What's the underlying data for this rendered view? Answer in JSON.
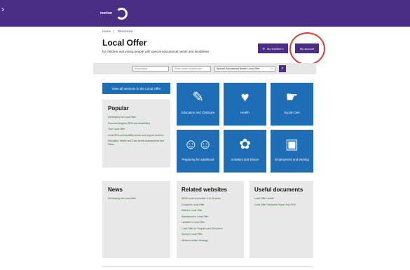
{
  "header": {
    "logo_text": "merton",
    "back_icon": "chevron-right-icon"
  },
  "breadcrumb": {
    "items": [
      "Home",
      "Directories"
    ]
  },
  "page": {
    "title": "Local Offer",
    "subtitle": "for children and young people with special educational needs and disabilities"
  },
  "actions": {
    "shortlist_label": "My shortlist 0",
    "account_label": "My account"
  },
  "search": {
    "keyword_placeholder": "Keyword(s)",
    "location_placeholder": "Place name or postcode",
    "category_value": "Special Educational Needs Local Offer",
    "submit_icon": "search-icon"
  },
  "view_all_label": "View all services in the Local Offer",
  "popular": {
    "title": "Popular",
    "links": [
      "Developing the Local Offer",
      "Personal Budgets (SEN and disabilities)",
      "Your Local Offer",
      "Local SEN and disability advice and support services",
      "Education, Health and Care Needs Assessments and Plans"
    ]
  },
  "tiles": [
    {
      "label": "Education and Childcare",
      "icon": "education-icon"
    },
    {
      "label": "Health",
      "icon": "heart-icon"
    },
    {
      "label": "Social Care",
      "icon": "hand-heart-icon"
    },
    {
      "label": "Preparing for adulthood",
      "icon": "family-icon"
    },
    {
      "label": "Activities and leisure",
      "icon": "activities-icon"
    },
    {
      "label": "Employment and training",
      "icon": "id-badge-icon"
    }
  ],
  "news": {
    "title": "News",
    "links": [
      "Developing the Local Offer"
    ]
  },
  "related": {
    "title": "Related websites",
    "links": [
      "SEND code of practice: 0 to 25 years",
      "Croydon's Local Offer",
      "Sutton's Local Offer",
      "Wandsworth's Local Offer",
      "Lambeth's Local Offer",
      "Local Offer for Kingston and Richmond",
      "Surrey's Local Offer",
      "Merton's Autism Strategy"
    ]
  },
  "useful": {
    "title": "Useful documents",
    "links": [
      "Local Offer Leaflet",
      "Local Offer Feedback Report July 2019"
    ]
  },
  "colors": {
    "brand": "#4a2e83",
    "tile": "#1f6db4",
    "panel": "#e8e8e8",
    "highlight": "#e53935"
  }
}
